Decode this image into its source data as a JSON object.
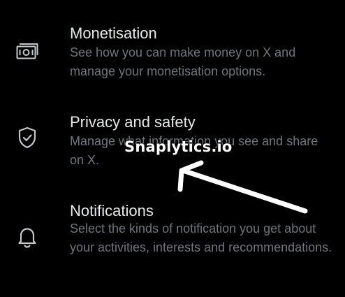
{
  "settings": {
    "items": [
      {
        "title": "Monetisation",
        "description": "See how you can make money on X and manage your monetisation options.",
        "icon": "money-icon"
      },
      {
        "title": "Privacy and safety",
        "description": "Manage what information you see and share on X.",
        "icon": "shield-check-icon"
      },
      {
        "title": "Notifications",
        "description": "Select the kinds of notification you get about your activities, interests and recommendations.",
        "icon": "bell-icon"
      }
    ]
  },
  "overlay": {
    "watermark": "Snaplytics.io"
  },
  "colors": {
    "background": "#000000",
    "title": "#e7e9ea",
    "description": "#71767b",
    "icon": "#c4c7ca",
    "annotation": "#ffffff"
  }
}
